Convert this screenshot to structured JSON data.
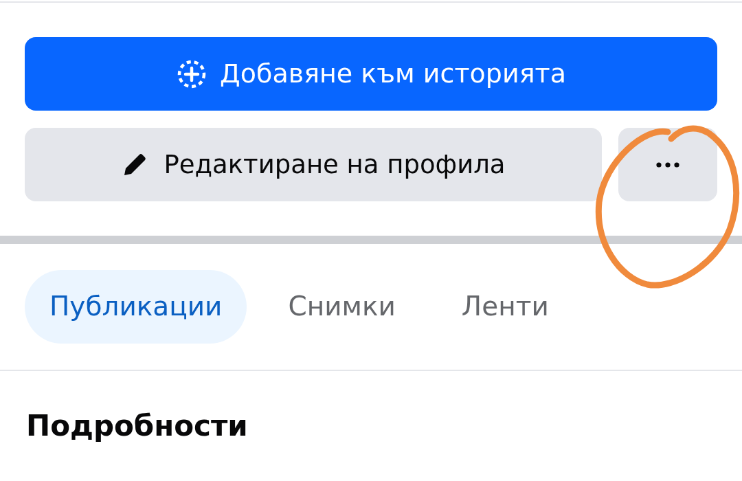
{
  "actions": {
    "add_story": {
      "label": "Добавяне към историята"
    },
    "edit_profile": {
      "label": "Редактиране на профила"
    }
  },
  "tabs": [
    {
      "label": "Публикации",
      "selected": true
    },
    {
      "label": "Снимки",
      "selected": false
    },
    {
      "label": "Ленти",
      "selected": false
    }
  ],
  "section": {
    "title": "Подробности"
  },
  "annotations": [
    {
      "kind": "freehand-circle"
    }
  ]
}
